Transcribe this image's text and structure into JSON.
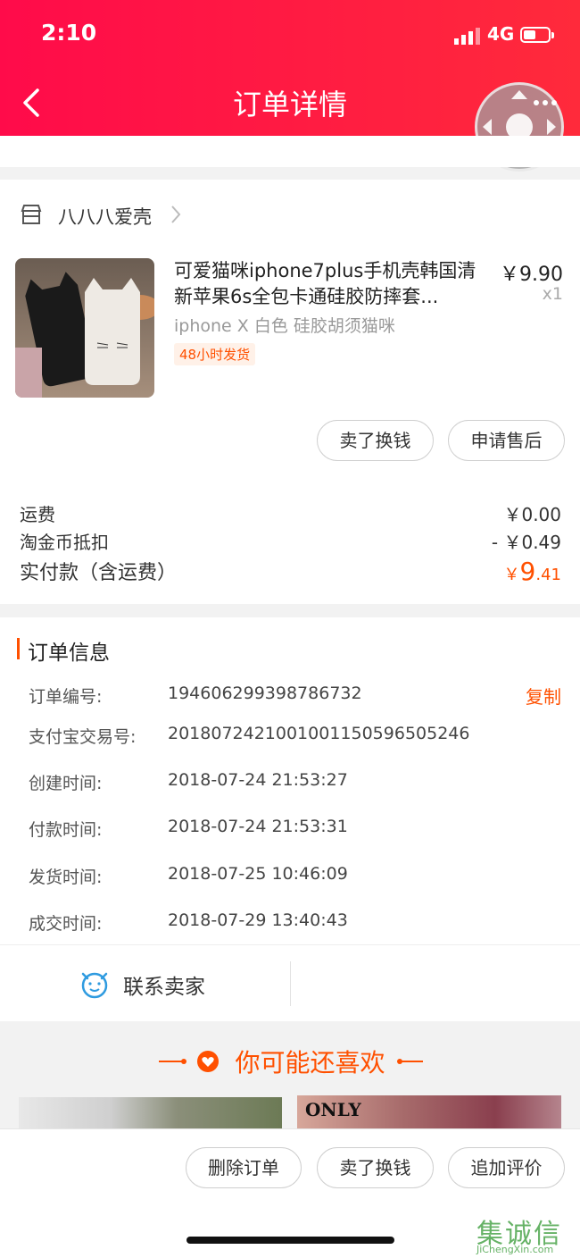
{
  "status_bar": {
    "time": "2:10",
    "network": "4G"
  },
  "header": {
    "title": "订单详情"
  },
  "shop": {
    "name": "八八八爱壳"
  },
  "product": {
    "title": "可爱猫咪iphone7plus手机壳韩国清新苹果6s全包卡通硅胶防摔套...",
    "price": "￥9.90",
    "quantity": "x1",
    "sku": "iphone X 白色 硅胶胡须猫咪",
    "tag": "48小时发货",
    "actions": [
      "卖了换钱",
      "申请售后"
    ]
  },
  "fees": {
    "shipping_label": "运费",
    "shipping_value": "￥0.00",
    "coin_label": "淘金币抵扣",
    "coin_value": "- ￥0.49",
    "paid_label": "实付款（含运费）",
    "paid_currency": "￥",
    "paid_int": "9",
    "paid_dec": ".41"
  },
  "order_info": {
    "title": "订单信息",
    "copy_label": "复制",
    "rows": [
      {
        "label": "订单编号:",
        "value": "194606299398786732"
      },
      {
        "label": "支付宝交易号:",
        "value": "2018072421001001150596505246"
      },
      {
        "label": "创建时间:",
        "value": "2018-07-24 21:53:27"
      },
      {
        "label": "付款时间:",
        "value": "2018-07-24 21:53:31"
      },
      {
        "label": "发货时间:",
        "value": "2018-07-25 10:46:09"
      },
      {
        "label": "成交时间:",
        "value": "2018-07-29 13:40:43"
      }
    ]
  },
  "contact": {
    "label": "联系卖家"
  },
  "recommend": {
    "title": "你可能还喜欢",
    "brand": "ONLY"
  },
  "bottom_actions": [
    "删除订单",
    "卖了换钱",
    "追加评价"
  ],
  "watermark": {
    "cn": "集诚信",
    "en": "JiChengXin.com"
  },
  "colors": {
    "header": "#ff1a46",
    "accent": "#ff5000"
  }
}
